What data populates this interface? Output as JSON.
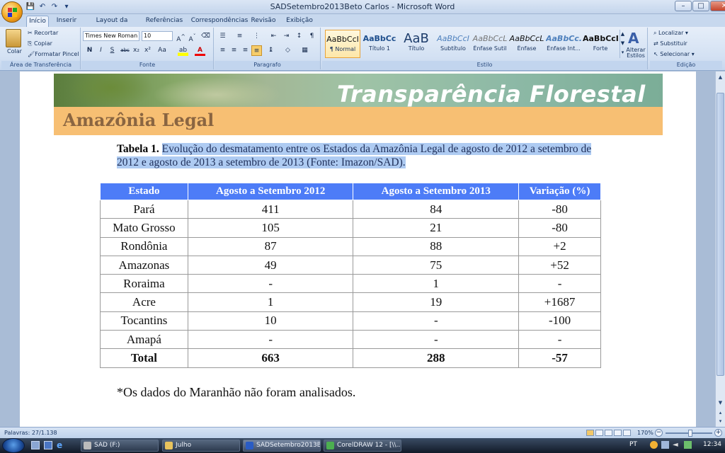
{
  "window": {
    "title": "SADSetembro2013Beto Carlos - Microsoft Word",
    "controls": {
      "minimize": "–",
      "maximize": "□",
      "close": "✕"
    }
  },
  "quick_access": {
    "save": "💾",
    "undo": "↶",
    "redo": "↷",
    "customize": "▾"
  },
  "tabs": [
    "Início",
    "Inserir",
    "Layout da Página",
    "Referências",
    "Correspondências",
    "Revisão",
    "Exibição"
  ],
  "clipboard": {
    "paste": "Colar",
    "cut": "Recortar",
    "copy": "Copiar",
    "format_painter": "Formatar Pincel",
    "label": "Área de Transferência"
  },
  "font": {
    "name": "Times New Roman",
    "size": "10",
    "label": "Fonte"
  },
  "paragraph": {
    "label": "Paragrafo"
  },
  "styles": {
    "label": "Estilo",
    "items": [
      {
        "sample": "AaBbCcI",
        "name": "¶ Normal"
      },
      {
        "sample": "AaBbCc",
        "name": "Título 1"
      },
      {
        "sample": "AaB",
        "name": "Título"
      },
      {
        "sample": "AaBbCcI",
        "name": "Subtítulo"
      },
      {
        "sample": "AaBbCcL",
        "name": "Ênfase Sutil"
      },
      {
        "sample": "AaBbCcL",
        "name": "Ênfase"
      },
      {
        "sample": "AaBbCc.",
        "name": "Ênfase Int..."
      },
      {
        "sample": "AaBbCcI",
        "name": "Forte"
      }
    ],
    "change_styles": "Alterar Estilos"
  },
  "editing": {
    "label": "Edição",
    "find": "Localizar",
    "replace": "Substituir",
    "select": "Selecionar"
  },
  "document": {
    "banner_title": "Transparência Florestal",
    "section_title": "Amazônia Legal",
    "caption_bold": "Tabela 1.",
    "caption_text": "Evolução do desmatamento entre os Estados da Amazônia Legal de agosto de 2012 a setembro de 2012 e agosto de 2013 a setembro de 2013 (Fonte: Imazon/SAD).",
    "table": {
      "headers": [
        "Estado",
        "Agosto a Setembro 2012",
        "Agosto a Setembro 2013",
        "Variação (%)"
      ],
      "rows": [
        [
          "Pará",
          "411",
          "84",
          "-80"
        ],
        [
          "Mato Grosso",
          "105",
          "21",
          "-80"
        ],
        [
          "Rondônia",
          "87",
          "88",
          "+2"
        ],
        [
          "Amazonas",
          "49",
          "75",
          "+52"
        ],
        [
          "Roraima",
          "-",
          "1",
          "-"
        ],
        [
          "Acre",
          "1",
          "19",
          "+1687"
        ],
        [
          "Tocantins",
          "10",
          "-",
          "-100"
        ],
        [
          "Amapá",
          "-",
          "-",
          "-"
        ]
      ],
      "total": [
        "Total",
        "663",
        "288",
        "-57"
      ]
    },
    "footnote": "*Os dados do Maranhão não foram analisados."
  },
  "status_bar": {
    "words": "Palavras: 27/1.138",
    "zoom": "170%"
  },
  "taskbar": {
    "items": [
      "SAD (F:)",
      "Julho",
      "SADSetembro2013B...",
      "CorelDRAW 12 - [\\\\..."
    ],
    "lang": "PT",
    "time": "12:34"
  },
  "colors": {
    "accent": "#4d7cf7",
    "banner_orange": "#f7bf73",
    "selection": "#aecbf2"
  }
}
